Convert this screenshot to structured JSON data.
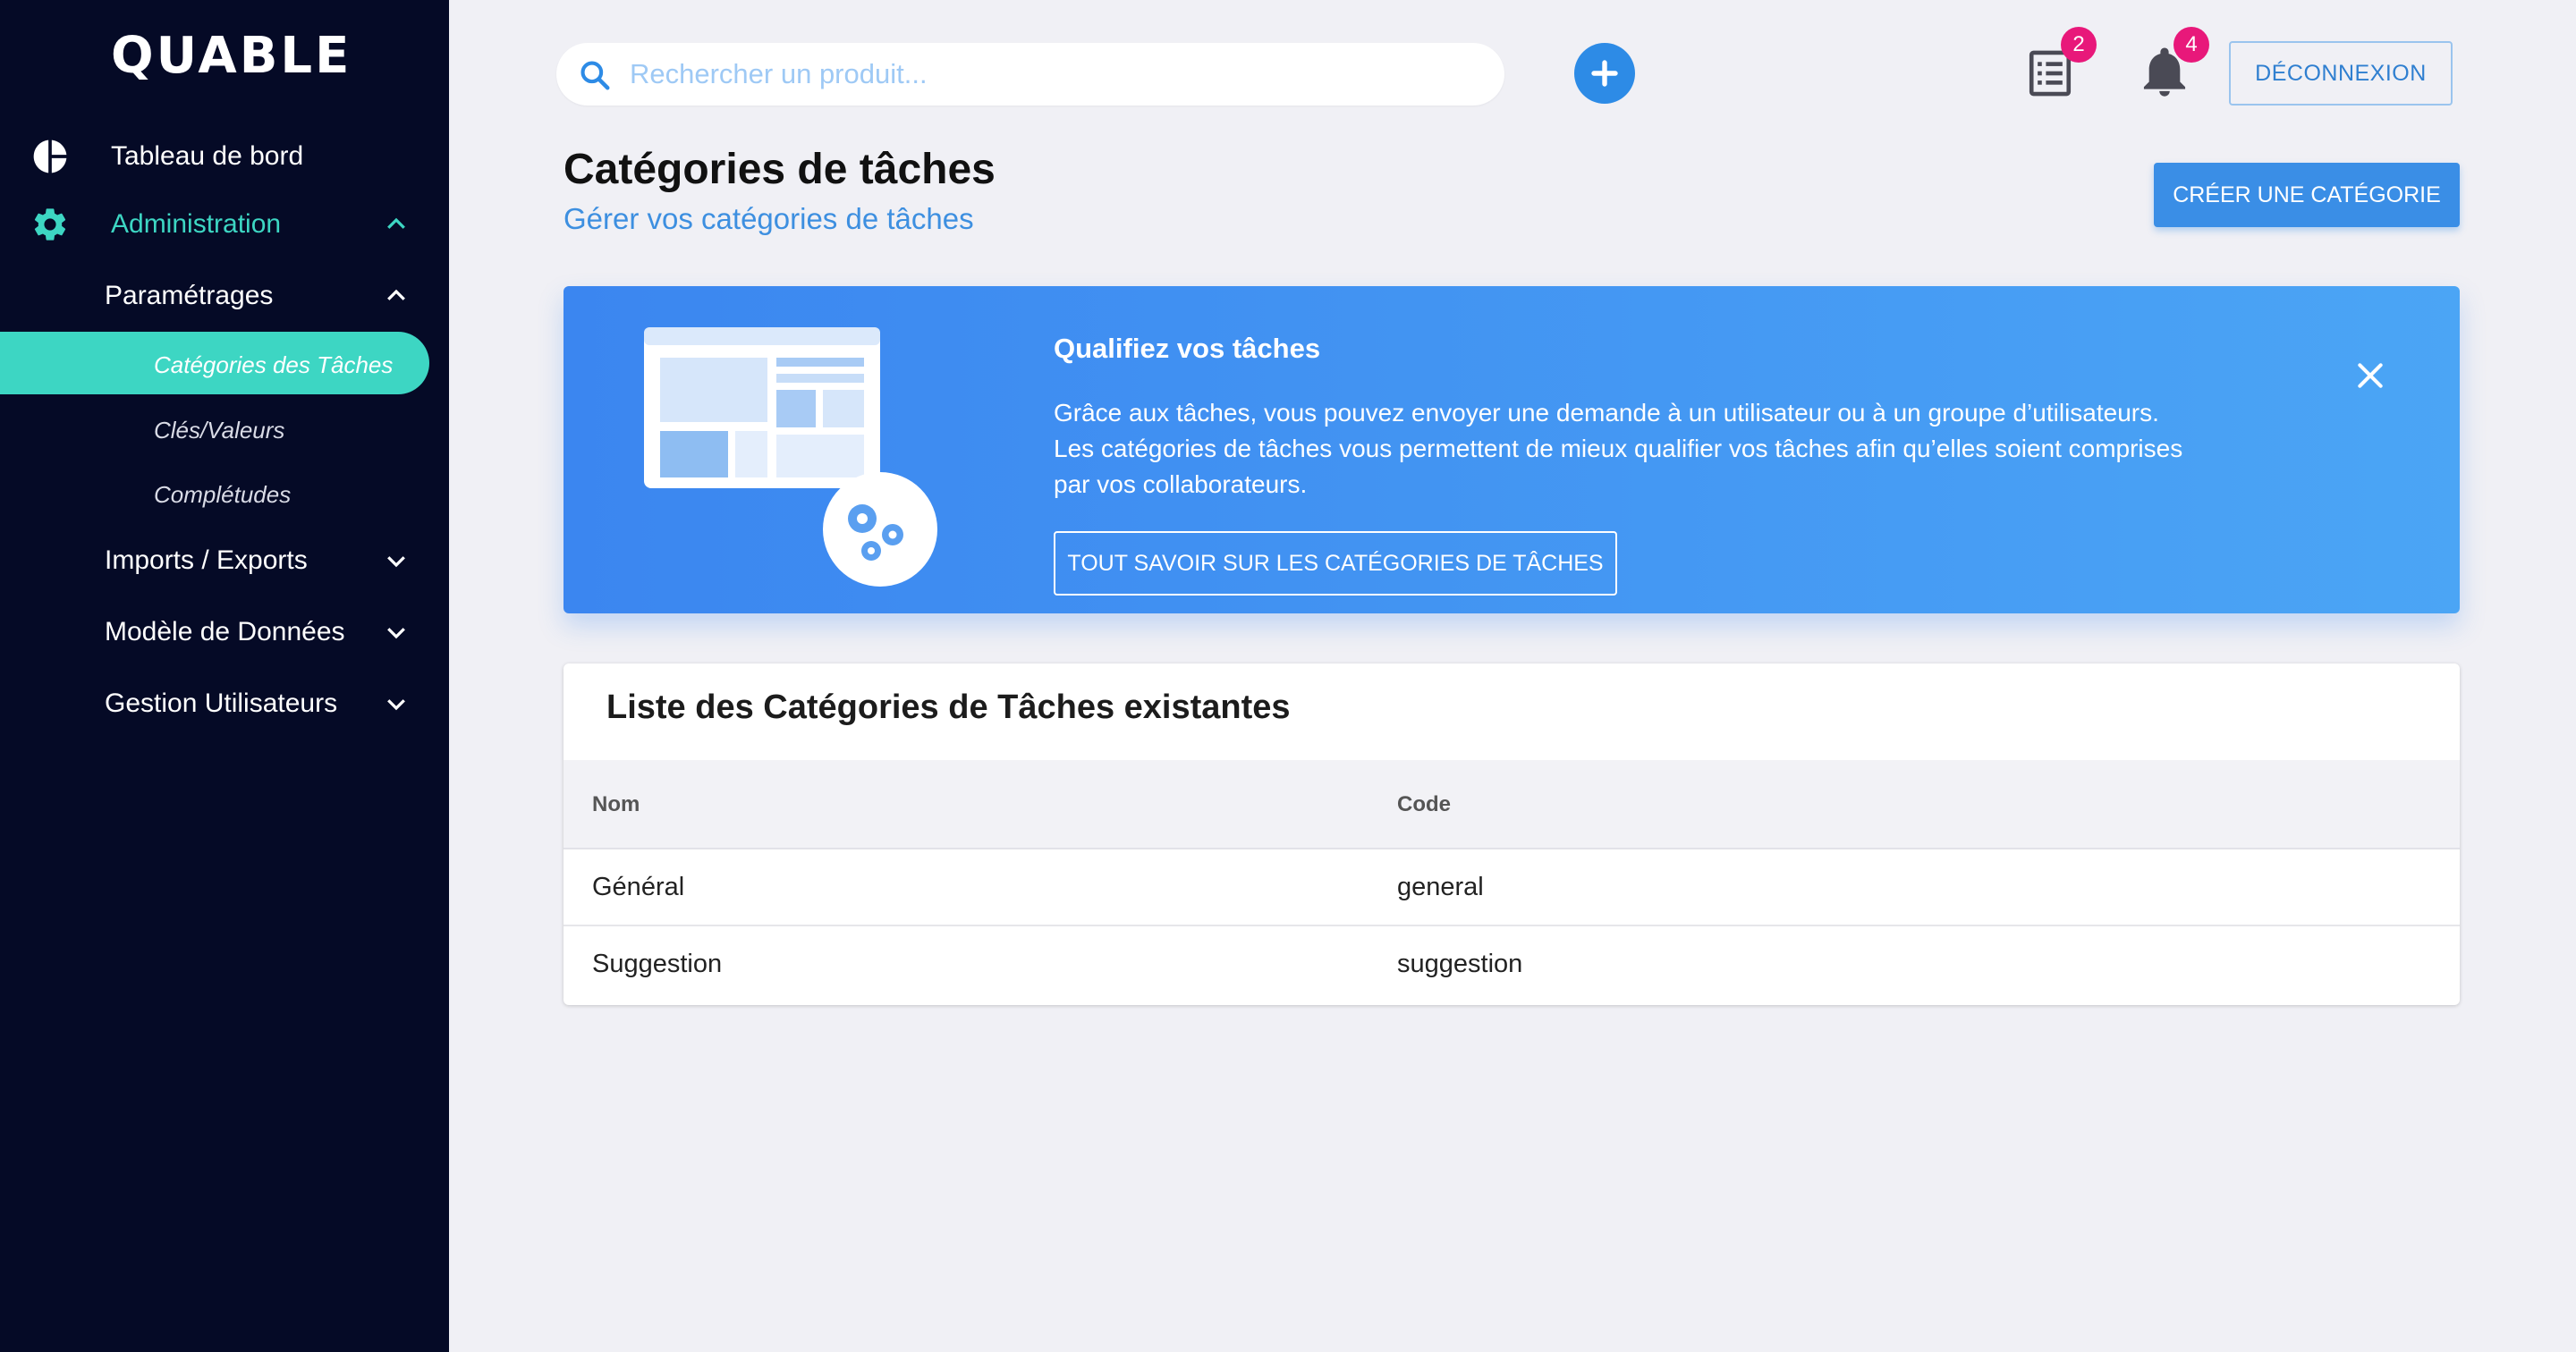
{
  "app": {
    "logo": "QUABLE"
  },
  "sidebar": {
    "items": [
      {
        "label": "Tableau de bord",
        "icon": "pie-chart-icon"
      },
      {
        "label": "Administration",
        "icon": "gear-icon",
        "expanded": true
      }
    ],
    "admin_sub": [
      {
        "label": "Paramétrages",
        "expanded": true
      },
      {
        "label": "Imports / Exports"
      },
      {
        "label": "Modèle de Données"
      },
      {
        "label": "Gestion Utilisateurs"
      }
    ],
    "params_sub": [
      {
        "label": "Catégories des Tâches",
        "active": true
      },
      {
        "label": "Clés/Valeurs"
      },
      {
        "label": "Complétudes"
      }
    ]
  },
  "topbar": {
    "search_placeholder": "Rechercher un produit...",
    "tasks_badge": "2",
    "notifications_badge": "4",
    "logout_label": "DÉCONNEXION"
  },
  "header": {
    "title": "Catégories de tâches",
    "subtitle": "Gérer vos catégories de tâches",
    "create_label": "CRÉER UNE CATÉGORIE"
  },
  "banner": {
    "title": "Qualifiez vos tâches",
    "lines": [
      "Grâce aux tâches, vous pouvez envoyer une demande à un utilisateur ou à un groupe d’utilisateurs.",
      "Les catégories de tâches vous permettent de mieux qualifier vos tâches afin qu’elles soient comprises",
      "par vos collaborateurs."
    ],
    "button_label": "TOUT SAVOIR SUR LES CATÉGORIES DE TÂCHES"
  },
  "table": {
    "title": "Liste des Catégories de Tâches existantes",
    "columns": [
      "Nom",
      "Code"
    ],
    "rows": [
      [
        "Général",
        "general"
      ],
      [
        "Suggestion",
        "suggestion"
      ]
    ]
  },
  "colors": {
    "sidebar_bg": "#050a26",
    "accent_teal": "#3dd6c3",
    "primary_blue": "#3a8ee6",
    "badge_pink": "#e8187a",
    "page_bg": "#f0f0f5"
  }
}
